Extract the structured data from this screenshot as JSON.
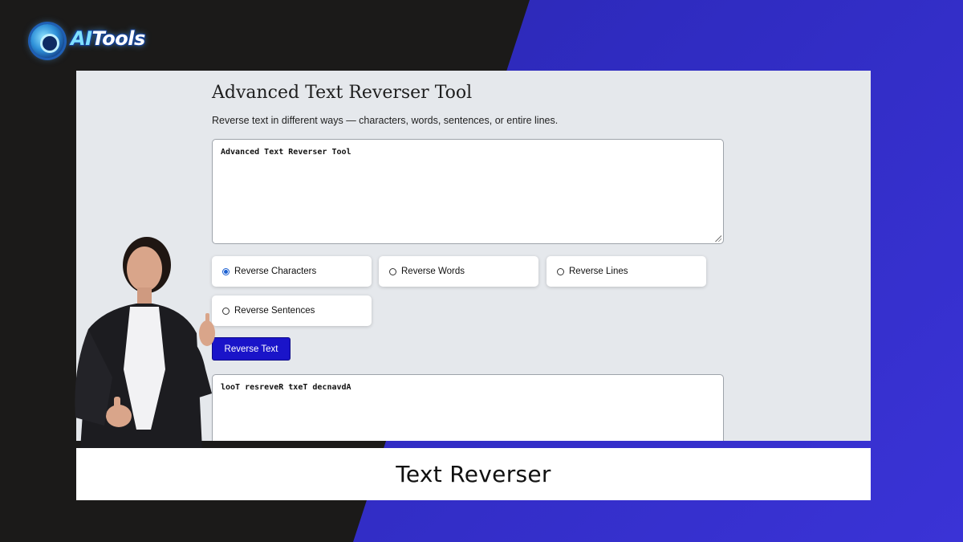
{
  "brand": {
    "logo_prefix": "AI",
    "logo_suffix": "Tools"
  },
  "app": {
    "title": "Advanced Text Reverser Tool",
    "subtitle": "Reverse text in different ways — characters, words, sentences, or entire lines.",
    "input_value": "Advanced Text Reverser Tool",
    "options": [
      {
        "label": "Reverse Characters",
        "selected": true
      },
      {
        "label": "Reverse Words",
        "selected": false
      },
      {
        "label": "Reverse Lines",
        "selected": false
      },
      {
        "label": "Reverse Sentences",
        "selected": false
      }
    ],
    "action_button": "Reverse Text",
    "output_value": "looT resreveR txeT decnavdA"
  },
  "caption": "Text Reverser",
  "colors": {
    "accent": "#1a14c9",
    "background_blue": "#2f2bc0",
    "background_dark": "#1b1a19"
  }
}
